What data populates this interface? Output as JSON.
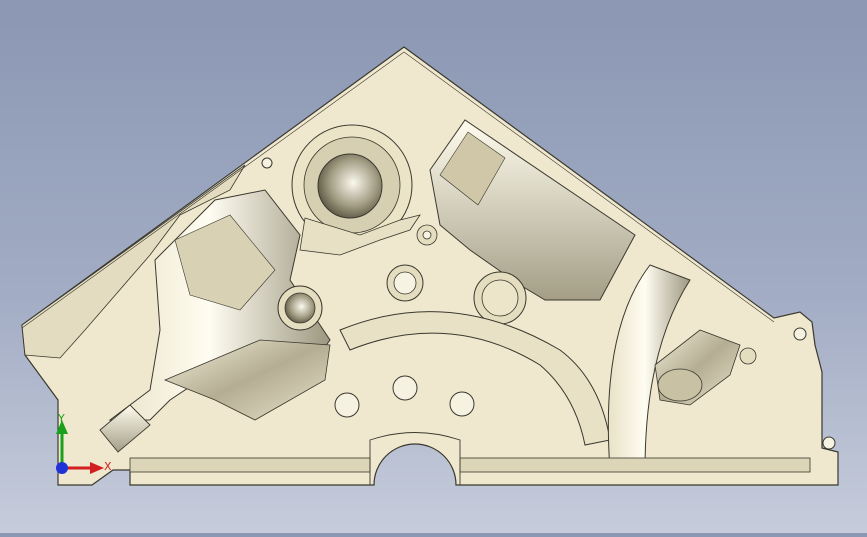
{
  "viewport": {
    "background_top": "#8b97b3",
    "background_bottom": "#c6ccdb",
    "part_color": "#efe8cf",
    "edge_color": "#3a382e"
  },
  "triad": {
    "x_label": "X",
    "y_label": "Y",
    "x_color": "#d21e1e",
    "y_color": "#1aa11a",
    "z_color": "#1f33d6"
  }
}
